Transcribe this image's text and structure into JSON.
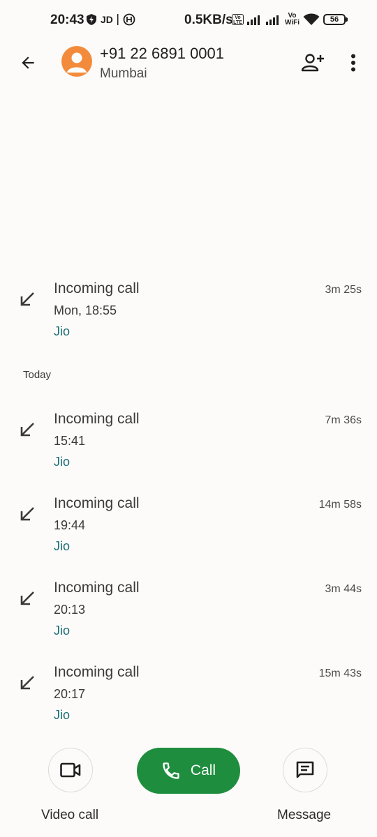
{
  "status_bar": {
    "time": "20:43",
    "carrier_badge": "JD",
    "network_speed": "0.5KB/s",
    "volte_label": "Vo LTE",
    "vowifi_label": "Vo WiFi",
    "battery_level": "56"
  },
  "header": {
    "contact_number": "+91 22 6891 0001",
    "contact_location": "Mumbai"
  },
  "calls_earlier": [
    {
      "type": "Incoming call",
      "time": "Mon, 18:55",
      "carrier": "Jio",
      "duration": "3m 25s"
    }
  ],
  "section_today": "Today",
  "calls_today": [
    {
      "type": "Incoming call",
      "time": "15:41",
      "carrier": "Jio",
      "duration": "7m 36s"
    },
    {
      "type": "Incoming call",
      "time": "19:44",
      "carrier": "Jio",
      "duration": "14m 58s"
    },
    {
      "type": "Incoming call",
      "time": "20:13",
      "carrier": "Jio",
      "duration": "3m 44s"
    },
    {
      "type": "Incoming call",
      "time": "20:17",
      "carrier": "Jio",
      "duration": "15m 43s"
    }
  ],
  "actions": {
    "video_call_label": "Video call",
    "call_label": "Call",
    "message_label": "Message"
  },
  "colors": {
    "avatar": "#f28c3c",
    "call_button": "#1e8e3e",
    "carrier_text": "#1a6e74"
  }
}
